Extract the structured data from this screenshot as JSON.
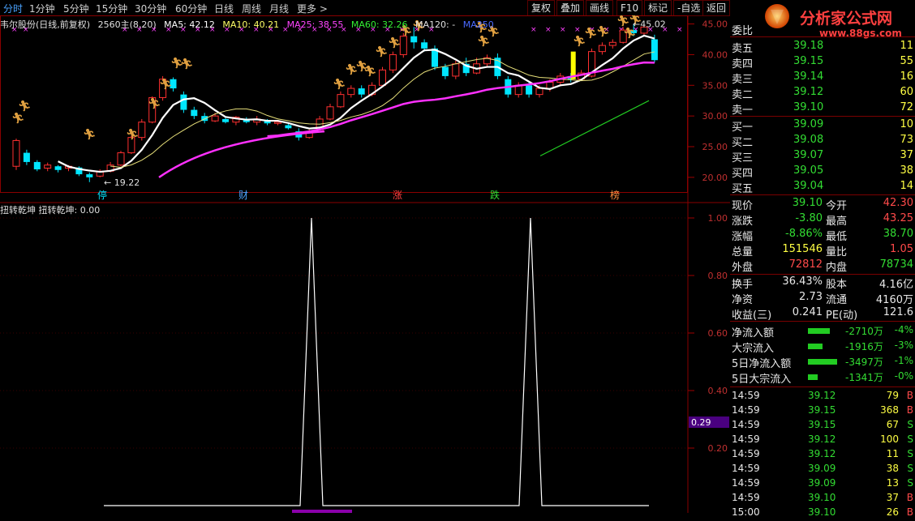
{
  "toolbar": {
    "tabs": [
      {
        "label": "分时",
        "active": true
      },
      {
        "label": "1分钟"
      },
      {
        "label": "5分钟"
      },
      {
        "label": "15分钟"
      },
      {
        "label": "30分钟"
      },
      {
        "label": "60分钟"
      },
      {
        "label": "日线"
      },
      {
        "label": "周线"
      },
      {
        "label": "月线"
      },
      {
        "label": "更多 >"
      }
    ],
    "buttons": [
      "复权",
      "叠加",
      "画线",
      "F10",
      "标记",
      "-自选",
      "返回"
    ]
  },
  "logo": {
    "title": "分析家公式网",
    "url_text": "www.88gs.com"
  },
  "chart_header": {
    "stock": "韦尔股份(日线,前复权)",
    "period": "2560主(8,20)",
    "ma5": "MA5: 42.12",
    "ma10": "MA10: 40.21",
    "ma25": "MA25: 38.55",
    "ma60": "MA60: 32.26",
    "ma120": "MA120: -",
    "ma250": "MA250"
  },
  "price_axis": [
    "45.00",
    "40.00",
    "35.00",
    "30.00",
    "25.00",
    "20.00"
  ],
  "price_labels": {
    "high": "45.02",
    "low": "19.22"
  },
  "events": [
    "停",
    "财",
    "涨",
    "跌",
    "榜"
  ],
  "indicator": {
    "title": "扭转乾坤 扭转乾坤: 0.00",
    "axis": [
      "1.00",
      "0.80",
      "0.60",
      "0.40",
      "0.20"
    ],
    "current": "0.29"
  },
  "orderbook": {
    "header": "委比",
    "asks": [
      {
        "label": "卖五",
        "price": "39.18",
        "vol": "11"
      },
      {
        "label": "卖四",
        "price": "39.15",
        "vol": "55"
      },
      {
        "label": "卖三",
        "price": "39.14",
        "vol": "16"
      },
      {
        "label": "卖二",
        "price": "39.12",
        "vol": "60"
      },
      {
        "label": "卖一",
        "price": "39.10",
        "vol": "72"
      }
    ],
    "bids": [
      {
        "label": "买一",
        "price": "39.09",
        "vol": "10"
      },
      {
        "label": "买二",
        "price": "39.08",
        "vol": "73"
      },
      {
        "label": "买三",
        "price": "39.07",
        "vol": "37"
      },
      {
        "label": "买四",
        "price": "39.05",
        "vol": "38"
      },
      {
        "label": "买五",
        "price": "39.04",
        "vol": "14"
      }
    ]
  },
  "quote": [
    {
      "l1": "现价",
      "v1": "39.10",
      "c1": "down",
      "l2": "今开",
      "v2": "42.30",
      "c2": "up"
    },
    {
      "l1": "涨跌",
      "v1": "-3.80",
      "c1": "down",
      "l2": "最高",
      "v2": "43.25",
      "c2": "up"
    },
    {
      "l1": "涨幅",
      "v1": "-8.86%",
      "c1": "down",
      "l2": "最低",
      "v2": "38.70",
      "c2": "down"
    },
    {
      "l1": "总量",
      "v1": "151546",
      "c1": "yel",
      "l2": "量比",
      "v2": "1.05",
      "c2": "up"
    },
    {
      "l1": "外盘",
      "v1": "72812",
      "c1": "up",
      "l2": "内盘",
      "v2": "78734",
      "c2": "down"
    }
  ],
  "fundamentals": [
    {
      "l1": "换手",
      "v1": "36.43%",
      "l2": "股本",
      "v2": "4.16亿"
    },
    {
      "l1": "净资",
      "v1": "2.73",
      "l2": "流通",
      "v2": "4160万"
    },
    {
      "l1": "收益(三)",
      "v1": "0.241",
      "l2": "PE(动)",
      "v2": "121.6"
    }
  ],
  "flows": [
    {
      "label": "净流入额",
      "value": "-2710万",
      "pct": "-4%",
      "bar": 0.45
    },
    {
      "label": "大宗流入",
      "value": "-1916万",
      "pct": "-3%",
      "bar": 0.3
    },
    {
      "label": "5日净流入额",
      "value": "-3497万",
      "pct": "-1%",
      "bar": 0.6
    },
    {
      "label": "5日大宗流入",
      "value": "-1341万",
      "pct": "-0%",
      "bar": 0.2
    }
  ],
  "ticks": [
    {
      "time": "14:59",
      "price": "39.12",
      "vol": "79",
      "side": "B"
    },
    {
      "time": "14:59",
      "price": "39.15",
      "vol": "368",
      "side": "B"
    },
    {
      "time": "14:59",
      "price": "39.15",
      "vol": "67",
      "side": "S"
    },
    {
      "time": "14:59",
      "price": "39.12",
      "vol": "100",
      "side": "S"
    },
    {
      "time": "14:59",
      "price": "39.12",
      "vol": "11",
      "side": "S"
    },
    {
      "time": "14:59",
      "price": "39.09",
      "vol": "38",
      "side": "S"
    },
    {
      "time": "14:59",
      "price": "39.09",
      "vol": "13",
      "side": "S"
    },
    {
      "time": "14:59",
      "price": "39.10",
      "vol": "37",
      "side": "B"
    },
    {
      "time": "15:00",
      "price": "39.10",
      "vol": "26",
      "side": "B"
    }
  ],
  "chart_data": {
    "type": "candlestick",
    "ylim": [
      18,
      46
    ],
    "candles": [
      [
        21.8,
        26.0,
        21.2,
        26.3
      ],
      [
        24.0,
        22.5,
        22.0,
        24.5
      ],
      [
        22.5,
        21.3,
        21.0,
        22.8
      ],
      [
        21.5,
        22.0,
        21.0,
        22.4
      ],
      [
        21.8,
        21.2,
        20.8,
        22.0
      ],
      [
        21.5,
        21.8,
        21.0,
        22.0
      ],
      [
        21.6,
        20.5,
        20.2,
        21.8
      ],
      [
        20.5,
        20.0,
        19.22,
        20.8
      ],
      [
        20.2,
        21.0,
        20.0,
        21.3
      ],
      [
        21.0,
        22.0,
        20.8,
        22.5
      ],
      [
        22.0,
        24.0,
        21.8,
        24.3
      ],
      [
        24.0,
        26.5,
        23.8,
        26.8
      ],
      [
        26.5,
        29.0,
        26.0,
        29.5
      ],
      [
        29.0,
        33.0,
        28.8,
        33.2
      ],
      [
        33.0,
        36.0,
        32.5,
        36.5
      ],
      [
        36.0,
        34.5,
        34.0,
        36.3
      ],
      [
        33.5,
        31.0,
        30.5,
        34.0
      ],
      [
        31.0,
        30.0,
        29.5,
        31.5
      ],
      [
        30.0,
        29.2,
        28.8,
        30.5
      ],
      [
        29.2,
        30.0,
        29.0,
        30.5
      ],
      [
        29.5,
        29.0,
        28.8,
        29.8
      ],
      [
        29.0,
        29.8,
        28.5,
        30.0
      ],
      [
        29.5,
        29.0,
        28.8,
        29.8
      ],
      [
        29.0,
        29.5,
        28.5,
        30.0
      ],
      [
        29.2,
        28.8,
        28.5,
        29.5
      ],
      [
        28.8,
        29.0,
        28.5,
        29.3
      ],
      [
        28.5,
        28.0,
        27.8,
        28.8
      ],
      [
        27.5,
        26.5,
        26.0,
        28.0
      ],
      [
        26.5,
        27.5,
        26.3,
        27.8
      ],
      [
        27.5,
        29.5,
        27.3,
        30.0
      ],
      [
        29.5,
        31.5,
        29.3,
        32.0
      ],
      [
        31.5,
        33.5,
        31.3,
        34.0
      ],
      [
        33.5,
        34.5,
        33.0,
        35.0
      ],
      [
        34.5,
        33.5,
        33.0,
        35.0
      ],
      [
        33.5,
        35.0,
        33.2,
        35.5
      ],
      [
        35.0,
        37.5,
        34.8,
        38.0
      ],
      [
        37.5,
        40.0,
        37.0,
        40.5
      ],
      [
        40.0,
        43.0,
        39.5,
        43.5
      ],
      [
        43.0,
        42.0,
        41.0,
        44.5
      ],
      [
        42.0,
        41.0,
        40.5,
        42.5
      ],
      [
        41.0,
        38.0,
        37.5,
        41.5
      ],
      [
        38.0,
        36.5,
        36.0,
        38.5
      ],
      [
        36.5,
        38.5,
        36.0,
        39.0
      ],
      [
        38.5,
        37.0,
        36.5,
        39.5
      ],
      [
        37.0,
        38.5,
        36.8,
        39.5
      ],
      [
        38.5,
        39.5,
        38.0,
        40.0
      ],
      [
        39.5,
        36.5,
        36.0,
        40.2
      ],
      [
        36.0,
        33.5,
        33.0,
        36.5
      ],
      [
        33.5,
        35.0,
        33.0,
        35.5
      ],
      [
        35.0,
        33.5,
        33.0,
        35.5
      ],
      [
        33.5,
        34.5,
        33.0,
        35.0
      ],
      [
        34.5,
        35.5,
        34.0,
        36.0
      ],
      [
        35.5,
        36.5,
        35.0,
        37.0
      ],
      [
        36.5,
        36.0,
        35.5,
        37.0
      ],
      [
        36.0,
        37.0,
        35.8,
        37.5
      ],
      [
        36.5,
        40.5,
        36.3,
        41.0
      ],
      [
        40.5,
        41.5,
        40.0,
        42.0
      ],
      [
        41.5,
        42.0,
        41.0,
        42.5
      ],
      [
        42.0,
        44.0,
        41.8,
        44.5
      ],
      [
        44.0,
        43.5,
        43.0,
        45.02
      ],
      [
        43.5,
        44.5,
        43.0,
        45.0
      ],
      [
        42.5,
        39.1,
        38.7,
        43.25
      ]
    ]
  }
}
